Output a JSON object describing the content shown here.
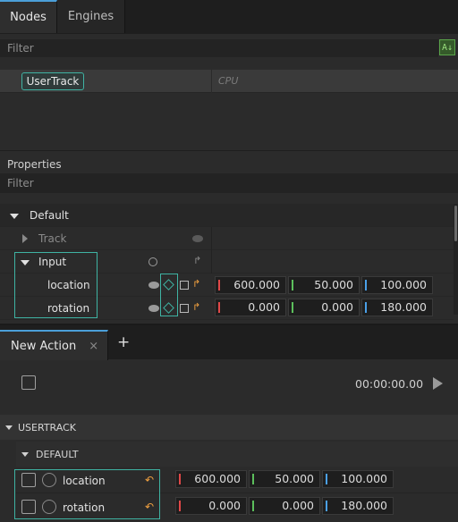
{
  "top_tabs": [
    {
      "label": "Nodes",
      "active": true
    },
    {
      "label": "Engines",
      "active": false
    }
  ],
  "nodes": {
    "filter_placeholder": "Filter",
    "sort_icon": "sort-az-icon",
    "row": {
      "name": "UserTrack",
      "column": "CPU"
    }
  },
  "properties": {
    "title": "Properties",
    "filter_placeholder": "Filter",
    "group": "Default",
    "track_label": "Track",
    "input_label": "Input",
    "rows": [
      {
        "label": "location",
        "x": "600.000",
        "y": "50.000",
        "z": "100.000"
      },
      {
        "label": "rotation",
        "x": "0.000",
        "y": "0.000",
        "z": "180.000"
      }
    ]
  },
  "action": {
    "tab_label": "New Action",
    "close_glyph": "×",
    "add_glyph": "+",
    "time": "00:00:00.00",
    "track_header": "USERTRACK",
    "sub_header": "DEFAULT",
    "rows": [
      {
        "label": "location",
        "x": "600.000",
        "y": "50.000",
        "z": "100.000"
      },
      {
        "label": "rotation",
        "x": "0.000",
        "y": "0.000",
        "z": "180.000"
      }
    ]
  },
  "colors": {
    "accent": "#3fb3a3",
    "x_axis": "#e04848",
    "y_axis": "#5cbf5c",
    "z_axis": "#4aa0e8",
    "keyframe": "#f0a040"
  }
}
